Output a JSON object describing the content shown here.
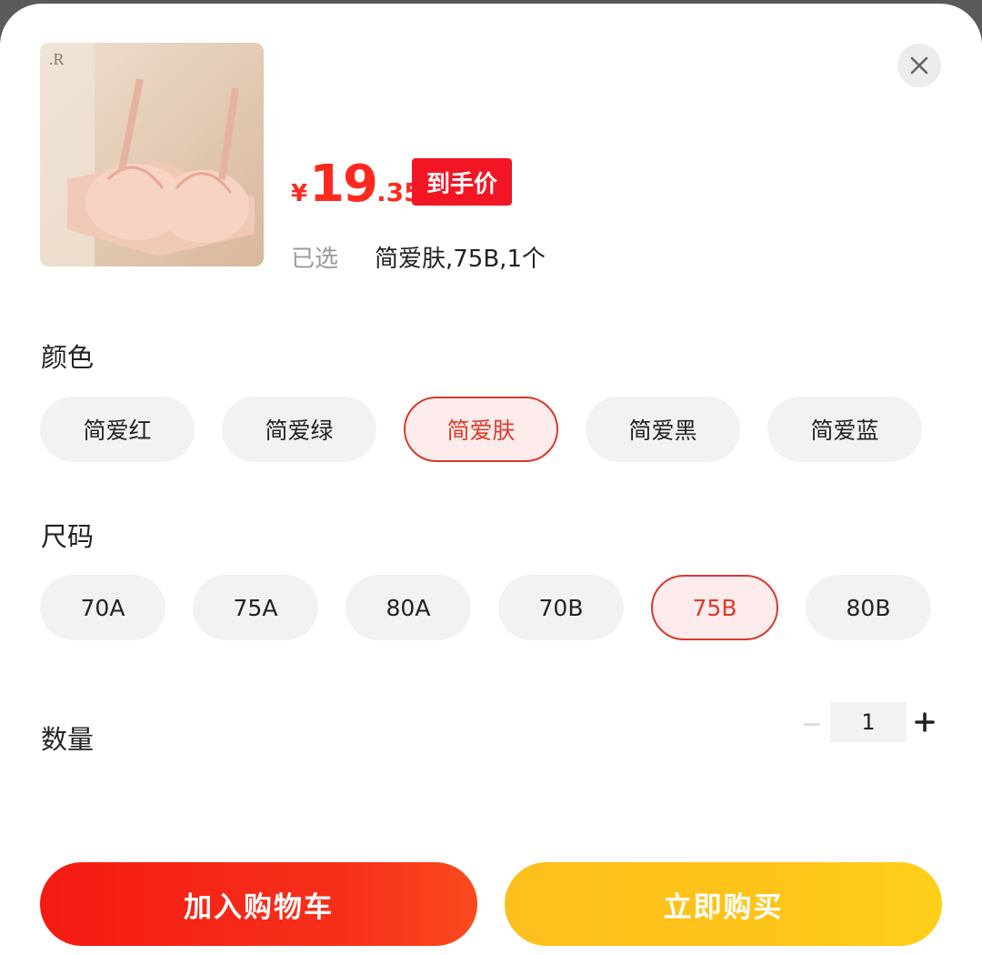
{
  "product": {
    "image_icon": "product-photo-bra",
    "price_currency": "¥",
    "price_integer": "19",
    "price_decimal": ".35",
    "price_tag": "到手价",
    "selected_label": "已选",
    "selected_value": "简爱肤,75B,1个"
  },
  "color_section": {
    "title": "颜色",
    "options": [
      {
        "label": "简爱红",
        "selected": false
      },
      {
        "label": "简爱绿",
        "selected": false
      },
      {
        "label": "简爱肤",
        "selected": true
      },
      {
        "label": "简爱黑",
        "selected": false
      },
      {
        "label": "简爱蓝",
        "selected": false
      }
    ]
  },
  "size_section": {
    "title": "尺码",
    "options": [
      {
        "label": "70A",
        "selected": false
      },
      {
        "label": "75A",
        "selected": false
      },
      {
        "label": "80A",
        "selected": false
      },
      {
        "label": "70B",
        "selected": false
      },
      {
        "label": "75B",
        "selected": true
      },
      {
        "label": "80B",
        "selected": false
      }
    ]
  },
  "quantity": {
    "label": "数量",
    "value": "1",
    "minus_icon": "minus-icon",
    "plus_icon": "plus-icon"
  },
  "buttons": {
    "add_to_cart": "加入购物车",
    "buy_now": "立即购买"
  },
  "colors": {
    "price_red": "#ff2a1f",
    "tag_red": "#f21625",
    "selected_border": "#d63a2e",
    "cart_button": "#f51a12",
    "buy_button": "#fec41a"
  }
}
